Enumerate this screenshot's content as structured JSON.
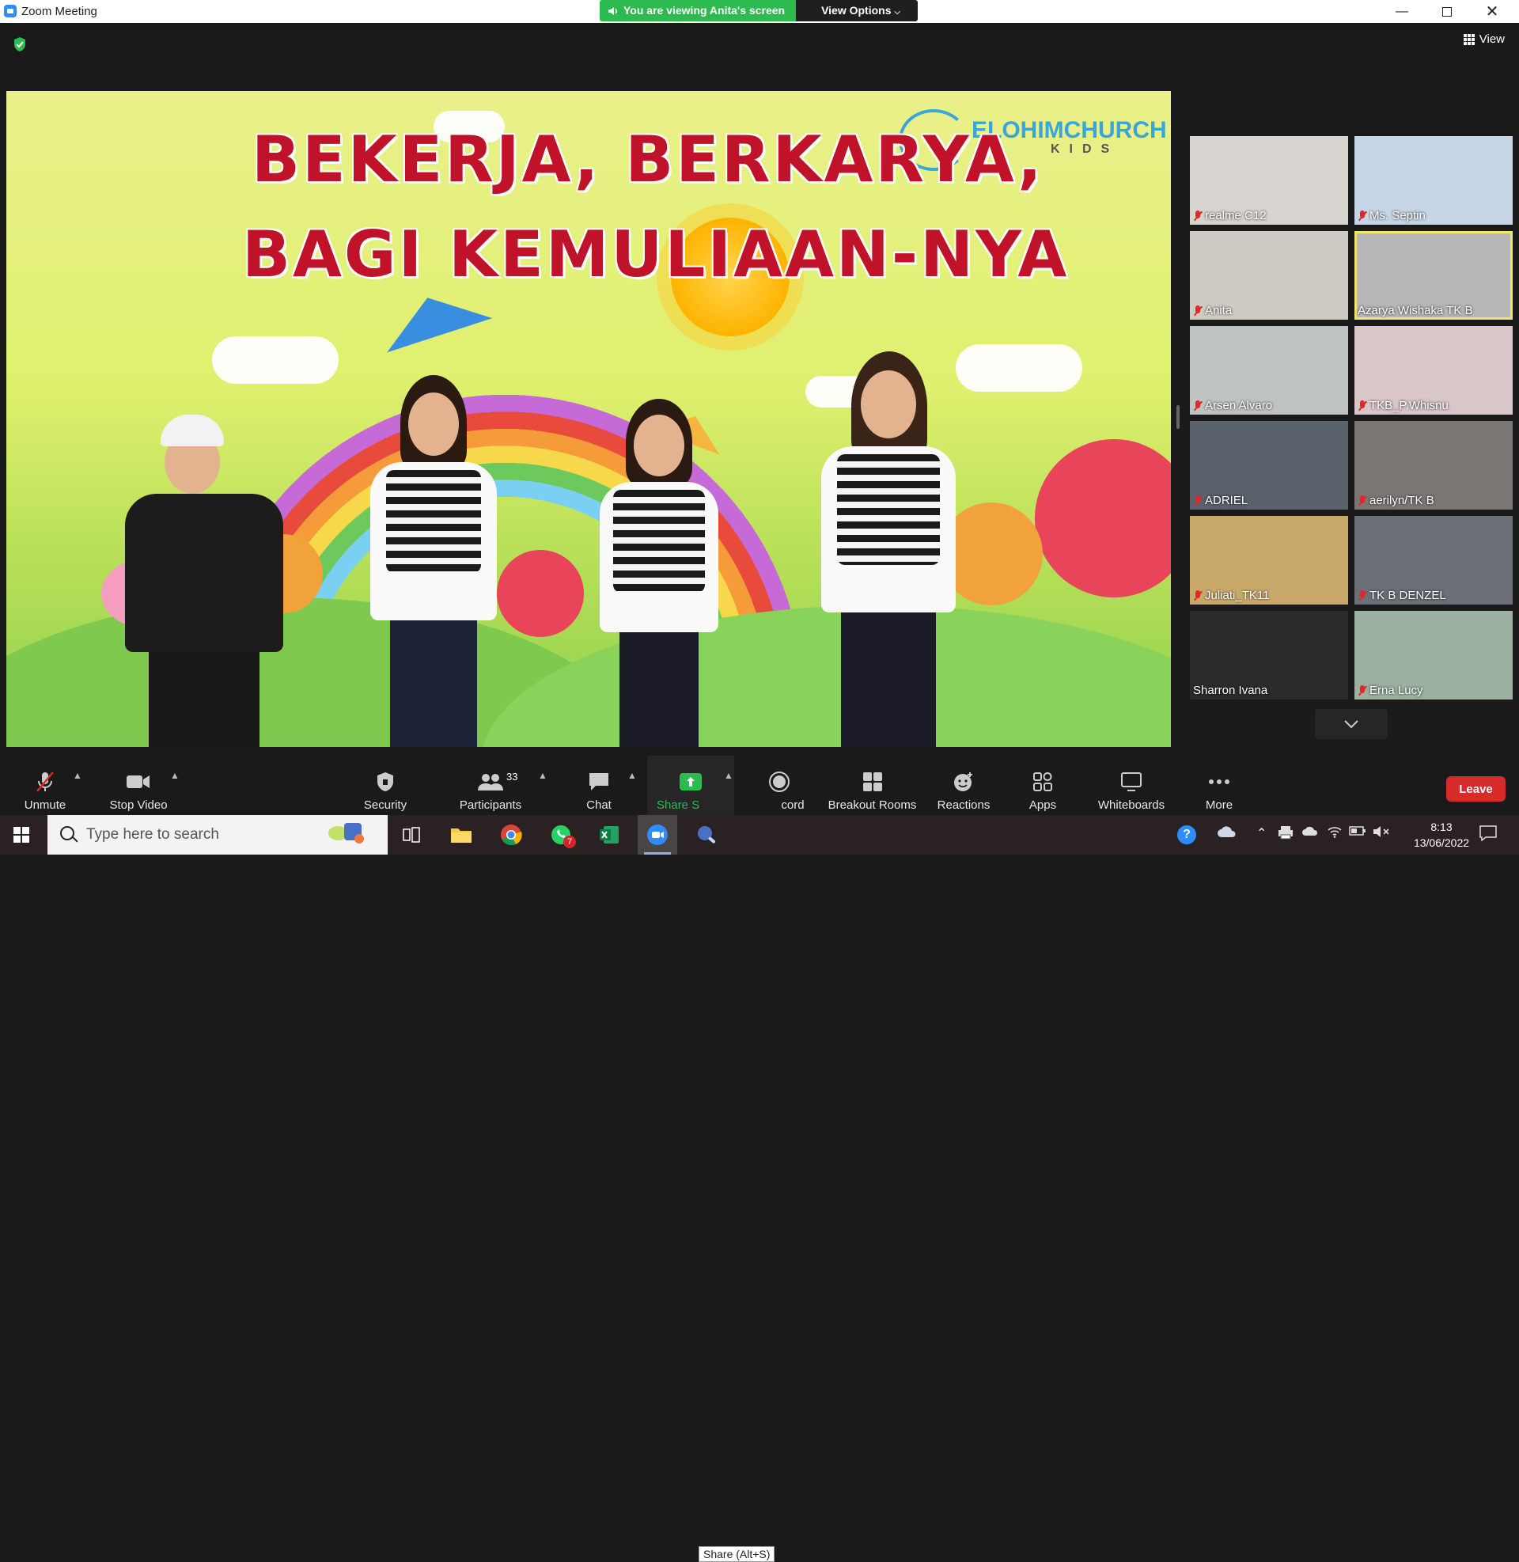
{
  "window": {
    "title": "Zoom Meeting"
  },
  "share_banner": {
    "viewing_text": "You are viewing Anita's screen",
    "options_label": "View Options"
  },
  "view_button": {
    "label": "View"
  },
  "slide": {
    "title_line1": "BEKERJA, BERKARYA,",
    "title_line2": "BAGI KEMULIAAN-NYA",
    "logo_name": "ELOHIMCHURCH",
    "logo_sub": "KIDS"
  },
  "participants": [
    {
      "name": "realme C12",
      "muted": true,
      "bg": "#d8d4cf"
    },
    {
      "name": "Ms. Septin",
      "muted": true,
      "bg": "#c7d6e6"
    },
    {
      "name": "Anita",
      "muted": true,
      "bg": "#cfcac4"
    },
    {
      "name": "Azarya Wishaka  TK B",
      "muted": false,
      "bg": "#b7b7b7",
      "active": true
    },
    {
      "name": "Arsen Alvaro",
      "muted": true,
      "bg": "#bfc3c2"
    },
    {
      "name": "TKB_P.Whisnu",
      "muted": true,
      "bg": "#d9c6c9"
    },
    {
      "name": "ADRIEL",
      "muted": true,
      "bg": "#59616a"
    },
    {
      "name": "aerilyn/TK B",
      "muted": true,
      "bg": "#7b7673"
    },
    {
      "name": "Juliati_TK11",
      "muted": true,
      "bg": "#c9a96a"
    },
    {
      "name": "TK B DENZEL",
      "muted": true,
      "bg": "#6a7076"
    },
    {
      "name": "Sharron Ivana",
      "muted": false,
      "bg": "#2b2b2b"
    },
    {
      "name": "Erna Lucy",
      "muted": true,
      "bg": "#9bb0a0"
    }
  ],
  "toolbar": {
    "unmute": "Unmute",
    "stop_video": "Stop Video",
    "security": "Security",
    "participants": "Participants",
    "participants_count": "33",
    "chat": "Chat",
    "share": "Share S",
    "share_tooltip": "Share (Alt+S)",
    "record": "cord",
    "breakout": "Breakout Rooms",
    "reactions": "Reactions",
    "apps": "Apps",
    "whiteboards": "Whiteboards",
    "more": "More",
    "leave": "Leave"
  },
  "taskbar": {
    "search_placeholder": "Type here to search",
    "time": "8:13",
    "date": "13/06/2022",
    "whatsapp_badge": "7"
  },
  "colors": {
    "zoom_blue": "#2d8cff",
    "share_green": "#2dbb4f",
    "leave_red": "#d72a2a",
    "active_speaker": "#f2e66a"
  }
}
